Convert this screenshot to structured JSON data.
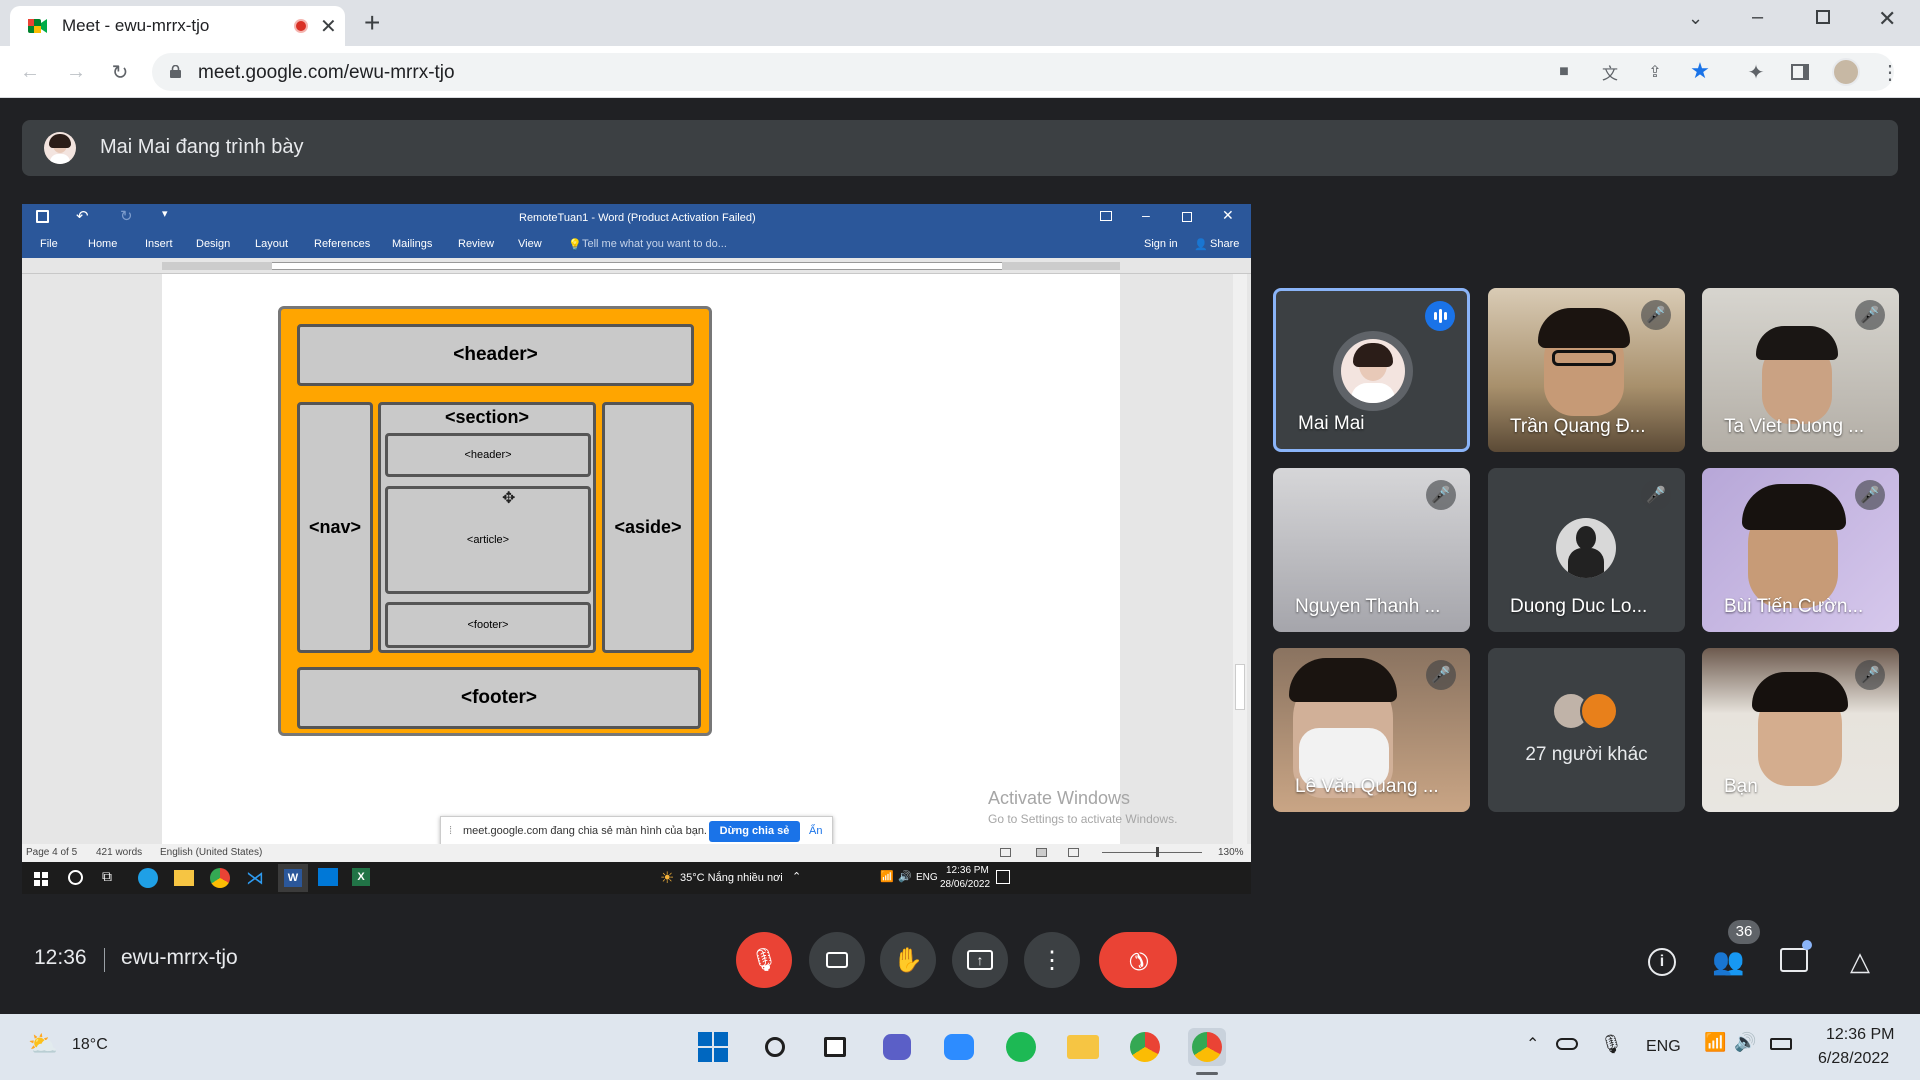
{
  "browser": {
    "tab_title": "Meet - ewu-mrrx-tjo",
    "url": "meet.google.com/ewu-mrrx-tjo"
  },
  "meet": {
    "presenter_text": "Mai Mai đang trình bày",
    "time": "12:36",
    "meeting_code": "ewu-mrrx-tjo",
    "participant_count": "36",
    "tiles": [
      {
        "name": "Mai Mai",
        "speaking": true
      },
      {
        "name": "Trần Quang Đ...",
        "muted": true
      },
      {
        "name": "Ta Viet Duong ...",
        "muted": true
      },
      {
        "name": "Nguyen Thanh ...",
        "muted": true
      },
      {
        "name": "Duong Duc Lo...",
        "muted": true
      },
      {
        "name": "Bùi Tiến Cườn...",
        "muted": true
      },
      {
        "name": "Lê Văn Quang ...",
        "muted": true
      },
      {
        "name": "27 người khác"
      },
      {
        "name": "Bạn",
        "muted": true
      }
    ]
  },
  "word": {
    "title": "RemoteTuan1 - Word (Product Activation Failed)",
    "ribbon_tabs": [
      "File",
      "Home",
      "Insert",
      "Design",
      "Layout",
      "References",
      "Mailings",
      "Review",
      "View"
    ],
    "tell_me": "Tell me what you want to do...",
    "sign_in": "Sign in",
    "share": "Share",
    "diagram": {
      "header": "<header>",
      "section": "<section>",
      "inner_header": "<header>",
      "article": "<article>",
      "inner_footer": "<footer>",
      "nav": "<nav>",
      "aside": "<aside>",
      "footer": "<footer>"
    },
    "activate_title": "Activate Windows",
    "activate_sub": "Go to Settings to activate Windows.",
    "share_notice": "meet.google.com đang chia sẻ màn hình của bạn.",
    "stop_share": "Dừng chia sẻ",
    "hide": "Ẩn",
    "status_page": "Page 4 of 5",
    "status_words": "421 words",
    "status_lang": "English (United States)",
    "zoom": "130%",
    "taskbar_weather": "35°C  Nắng nhiều nơi",
    "taskbar_lang": "ENG",
    "taskbar_time": "12:36 PM",
    "taskbar_date": "28/06/2022"
  },
  "win11": {
    "weather_temp": "18°C",
    "lang": "ENG",
    "time": "12:36 PM",
    "date": "6/28/2022"
  },
  "colors": {
    "meet_bg": "#202124",
    "tile_bg": "#3c4043",
    "word_blue": "#2b579a",
    "diagram_orange": "#ffa500",
    "end_call_red": "#ea4335",
    "meet_blue": "#1a73e8"
  }
}
